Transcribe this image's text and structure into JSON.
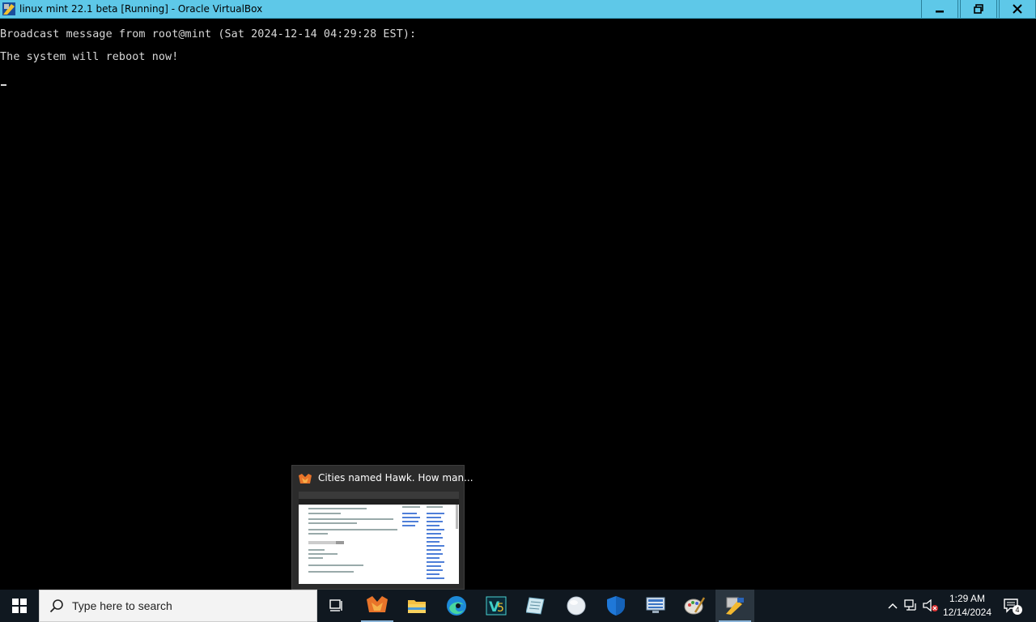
{
  "window": {
    "title": "linux mint 22.1 beta [Running] - Oracle VirtualBox",
    "buttons": [
      "minimize",
      "restore",
      "close"
    ]
  },
  "console": {
    "lines": [
      "Broadcast message from root@mint (Sat 2024-12-14 04:29:28 EST):",
      "The system will reboot now!"
    ]
  },
  "preview": {
    "title": "Cities named Hawk. How man..."
  },
  "taskbar": {
    "search_placeholder": "Type here to search",
    "apps": [
      "task-view",
      "firefox",
      "file-explorer",
      "edge",
      "visual-studio",
      "notepad",
      "app-globe",
      "windows-security",
      "remote-desktop",
      "paint",
      "virtualbox"
    ],
    "clock_time": "1:29 AM",
    "clock_date": "12/14/2024",
    "notification_count": "4"
  }
}
